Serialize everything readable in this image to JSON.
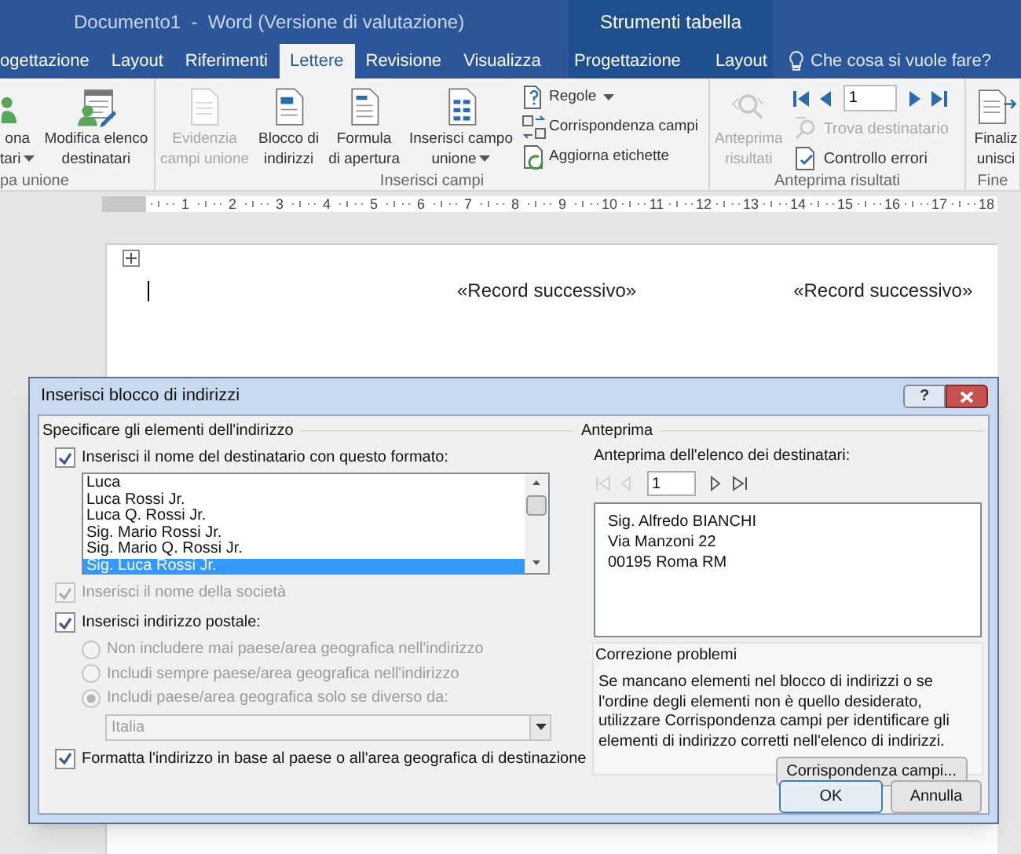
{
  "window": {
    "title": "Documento1  -  Word (Versione di valutazione)",
    "context_title": "Strumenti tabella"
  },
  "tabs": [
    {
      "label": "ogettazione",
      "selected": false,
      "contextual": false
    },
    {
      "label": "Layout",
      "selected": false,
      "contextual": false
    },
    {
      "label": "Riferimenti",
      "selected": false,
      "contextual": false
    },
    {
      "label": "Lettere",
      "selected": true,
      "contextual": false
    },
    {
      "label": "Revisione",
      "selected": false,
      "contextual": false
    },
    {
      "label": "Visualizza",
      "selected": false,
      "contextual": false
    },
    {
      "label": "Progettazione",
      "selected": false,
      "contextual": true
    },
    {
      "label": "Layout",
      "selected": false,
      "contextual": true
    }
  ],
  "tell_me": "Che cosa si vuole fare?",
  "ribbon": {
    "groups": [
      {
        "label": "pa unione",
        "items": [
          {
            "kind": "large",
            "lines": [
              "ona",
              "tari"
            ],
            "dropdown": true,
            "disabled": false
          },
          {
            "kind": "large",
            "lines": [
              "Modifica elenco",
              "destinatari"
            ],
            "dropdown": false,
            "disabled": false
          }
        ]
      },
      {
        "label": "Inserisci campi",
        "items": [
          {
            "kind": "large",
            "lines": [
              "Evidenzia",
              "campi unione"
            ],
            "dropdown": false,
            "disabled": true
          },
          {
            "kind": "large",
            "lines": [
              "Blocco di",
              "indirizzi"
            ],
            "dropdown": false,
            "disabled": false
          },
          {
            "kind": "large",
            "lines": [
              "Formula",
              "di apertura"
            ],
            "dropdown": false,
            "disabled": false
          },
          {
            "kind": "large",
            "lines": [
              "Inserisci campo",
              "unione"
            ],
            "dropdown": true,
            "disabled": false
          },
          {
            "kind": "small_stack",
            "items": [
              {
                "label": "Regole",
                "dropdown": true,
                "disabled": false
              },
              {
                "label": "Corrispondenza campi",
                "dropdown": false,
                "disabled": false
              },
              {
                "label": "Aggiorna etichette",
                "dropdown": false,
                "disabled": false
              }
            ]
          }
        ]
      },
      {
        "label": "Anteprima risultati",
        "items": [
          {
            "kind": "large",
            "lines": [
              "Anteprima",
              "risultati"
            ],
            "dropdown": false,
            "disabled": true
          },
          {
            "kind": "navigator",
            "record": "1",
            "items": [
              {
                "label": "Trova destinatario",
                "disabled": true
              },
              {
                "label": "Controllo errori",
                "disabled": false
              }
            ]
          }
        ]
      },
      {
        "label": "Fine",
        "items": [
          {
            "kind": "large",
            "lines": [
              "Finaliz",
              "unisci"
            ],
            "dropdown": false,
            "disabled": false
          }
        ]
      }
    ]
  },
  "ruler": {
    "numbers": [
      "1",
      "2",
      "3",
      "4",
      "5",
      "6",
      "7",
      "8",
      "9",
      "10",
      "11",
      "12",
      "13",
      "14",
      "15",
      "16",
      "17",
      "18"
    ]
  },
  "document": {
    "fields": [
      "«Record successivo»",
      "«Record successivo»"
    ]
  },
  "dialog": {
    "title": "Inserisci blocco di indirizzi",
    "help": "?",
    "address": {
      "title": "Specificare gli elementi dell'indirizzo",
      "controls": [
        {
          "kind": "checkbox",
          "label": "Inserisci il nome del destinatario con questo formato:",
          "checked": true,
          "disabled": false
        },
        {
          "kind": "listbox",
          "items": [
            {
              "label": "Luca",
              "selected": false
            },
            {
              "label": "Luca Rossi Jr.",
              "selected": false
            },
            {
              "label": "Luca Q. Rossi Jr.",
              "selected": false
            },
            {
              "label": "Sig. Mario Rossi Jr.",
              "selected": false
            },
            {
              "label": "Sig. Mario Q. Rossi Jr.",
              "selected": false
            },
            {
              "label": "Sig. Luca Rossi Jr.",
              "selected": true
            }
          ]
        },
        {
          "kind": "checkbox",
          "label": "Inserisci il nome della società",
          "checked": true,
          "disabled": true
        },
        {
          "kind": "checkbox",
          "label": "Inserisci indirizzo postale:",
          "checked": true,
          "disabled": false
        },
        {
          "kind": "radio",
          "label": "Non includere mai paese/area geografica nell'indirizzo",
          "selected": false,
          "disabled": true
        },
        {
          "kind": "radio",
          "label": "Includi sempre paese/area geografica nell'indirizzo",
          "selected": false,
          "disabled": true
        },
        {
          "kind": "radio",
          "label": "Includi paese/area geografica solo se diverso da:",
          "selected": true,
          "disabled": true
        },
        {
          "kind": "dropdown",
          "value": "Italia",
          "disabled": true
        },
        {
          "kind": "checkbox",
          "label": "Formatta l'indirizzo in base al paese o all'area geografica di destinazione",
          "checked": true,
          "disabled": false
        }
      ]
    },
    "preview": {
      "title": "Anteprima",
      "label": "Anteprima dell'elenco dei destinatari:",
      "record": "1",
      "nav": [
        {
          "disabled": true
        },
        {
          "disabled": true
        },
        {
          "disabled": false
        },
        {
          "disabled": false
        }
      ],
      "lines": [
        "Sig. Alfredo BIANCHI",
        "Via Manzoni 22",
        "00195 Roma RM"
      ]
    },
    "troubleshoot": {
      "title": "Correzione problemi",
      "text": "Se mancano elementi nel blocco di indirizzi o se l'ordine degli elementi non è quello desiderato, utilizzare Corrispondenza campi per identificare gli elementi di indirizzo corretti nell'elenco di indirizzi.",
      "button": "Corrispondenza campi..."
    },
    "buttons": [
      {
        "label": "OK",
        "default": true
      },
      {
        "label": "Annulla",
        "default": false
      }
    ]
  }
}
